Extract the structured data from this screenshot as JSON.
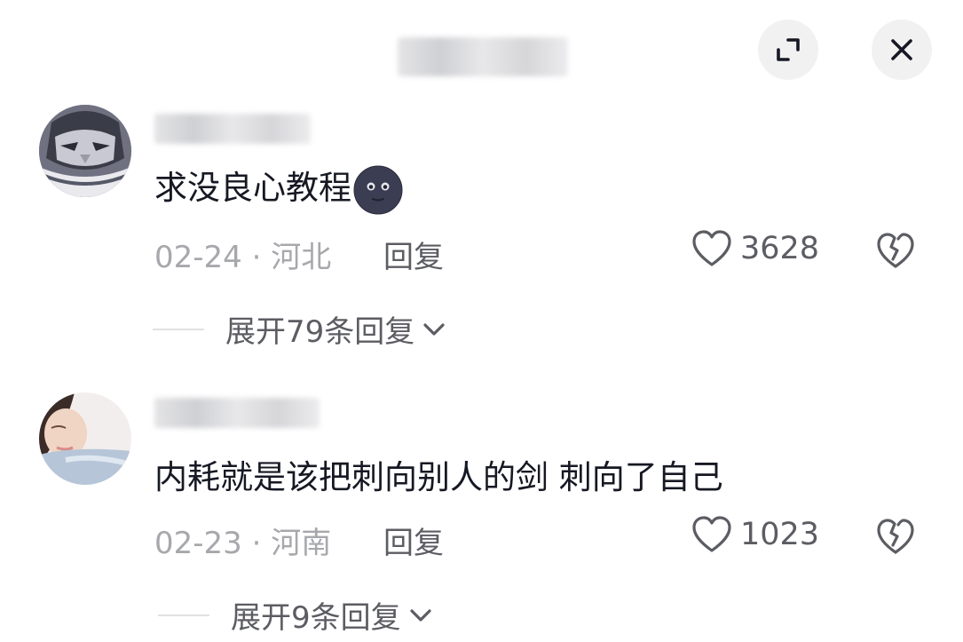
{
  "header": {
    "expand_icon": "expand-icon",
    "close_icon": "close-icon"
  },
  "comments": [
    {
      "text": "求没良心教程",
      "emoji": "new-moon-face-emoji",
      "date": "02-24",
      "separator": "·",
      "location": "河北",
      "reply_label": "回复",
      "likes": "3628",
      "expand_label": "展开79条回复"
    },
    {
      "text": "内耗就是该把刺向别人的剑 刺向了自己",
      "date": "02-23",
      "separator": "·",
      "location": "河南",
      "reply_label": "回复",
      "likes": "1023",
      "expand_label": "展开9条回复"
    }
  ],
  "colors": {
    "primary_text": "#161823",
    "secondary_text": "#a7a8ac",
    "action_text": "#5c5d63",
    "button_bg": "#f1f1f2"
  }
}
